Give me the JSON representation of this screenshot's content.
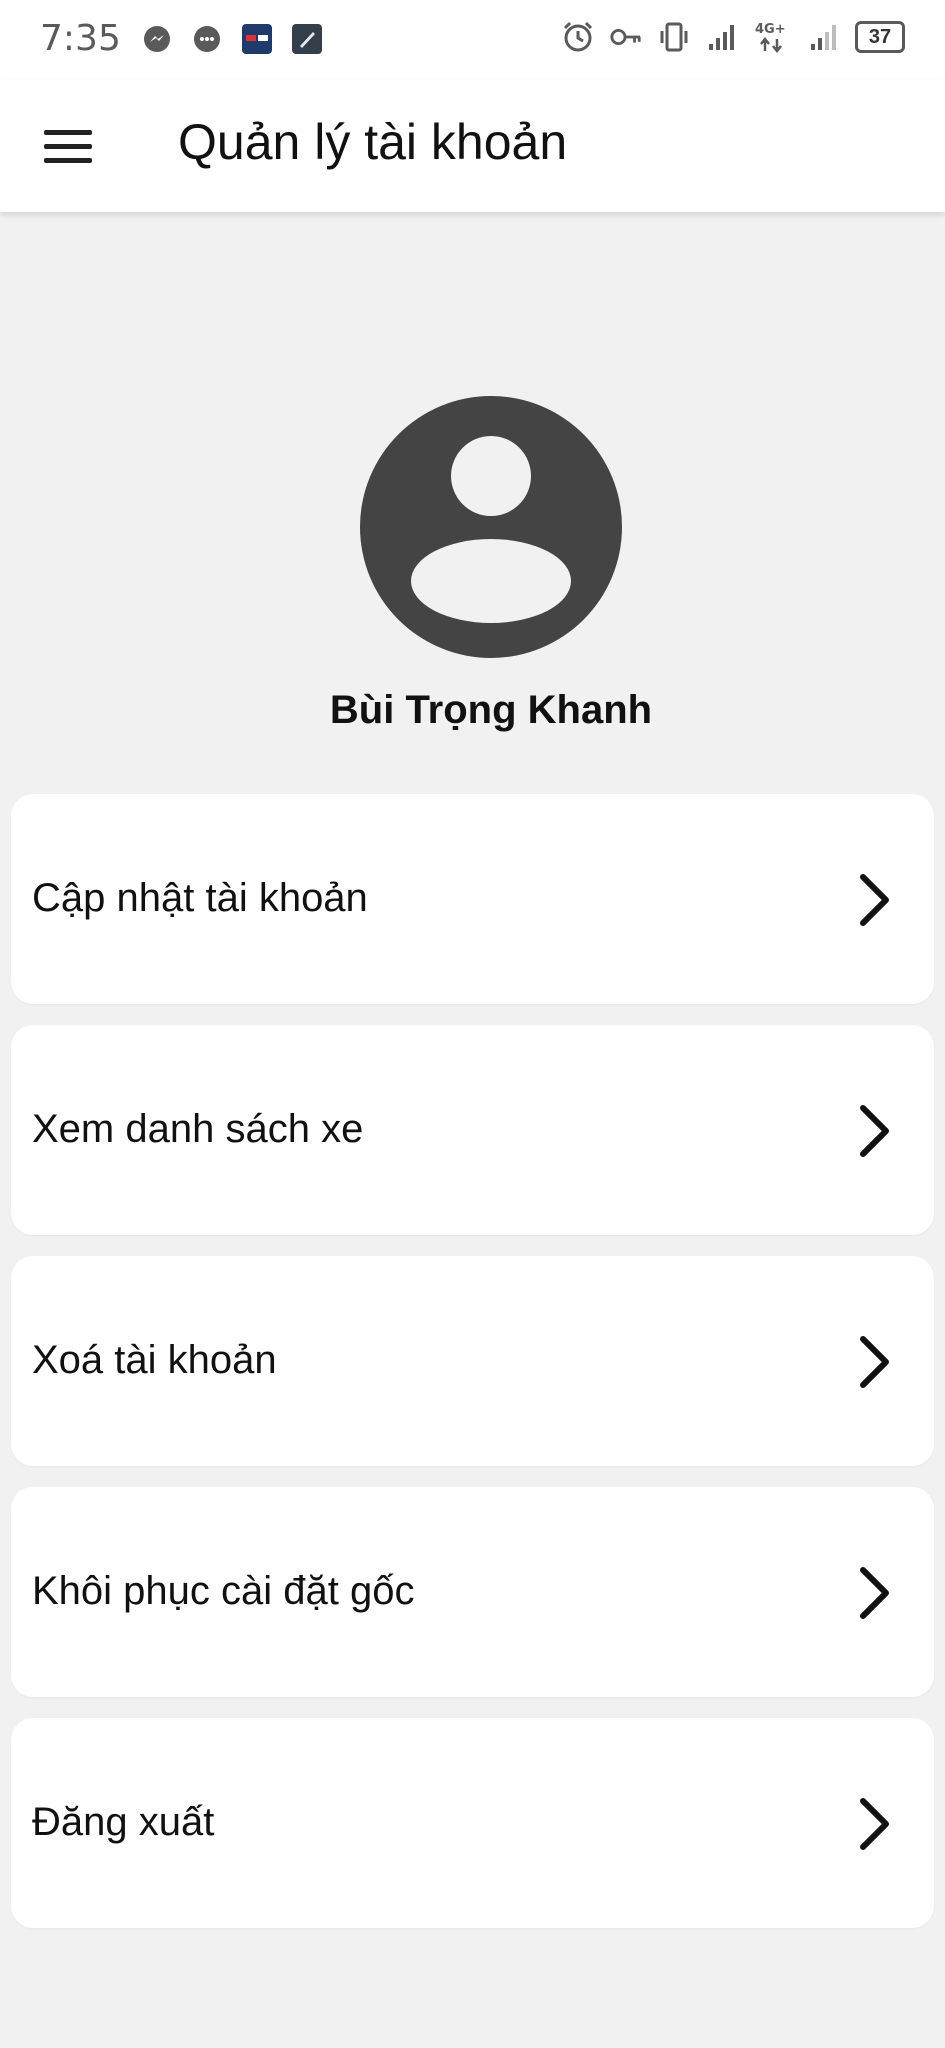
{
  "status_bar": {
    "time": "7:35",
    "left_icons": [
      "messenger-icon",
      "chat-bubble-icon",
      "app-badge-icon",
      "editor-app-icon"
    ],
    "right_icons": [
      "alarm-icon",
      "vpn-key-icon",
      "vibrate-icon",
      "signal-icon",
      "network-4g-icon",
      "signal-weak-icon"
    ],
    "network_label": "4G+",
    "battery": "37"
  },
  "app_bar": {
    "menu_icon": "hamburger-menu-icon",
    "title": "Quản lý tài khoản"
  },
  "profile": {
    "avatar_icon": "account-circle-icon",
    "name": "Bùi Trọng Khanh"
  },
  "menu": {
    "items": [
      {
        "label": "Cập nhật tài khoản",
        "icon": "chevron-right-icon"
      },
      {
        "label": "Xem danh sách xe",
        "icon": "chevron-right-icon"
      },
      {
        "label": "Xoá tài khoản",
        "icon": "chevron-right-icon"
      },
      {
        "label": "Khôi phục cài đặt gốc",
        "icon": "chevron-right-icon"
      },
      {
        "label": "Đăng xuất",
        "icon": "chevron-right-icon"
      }
    ]
  },
  "colors": {
    "background": "#f1f1f1",
    "card": "#ffffff",
    "avatar": "#444444",
    "text": "#111111"
  }
}
